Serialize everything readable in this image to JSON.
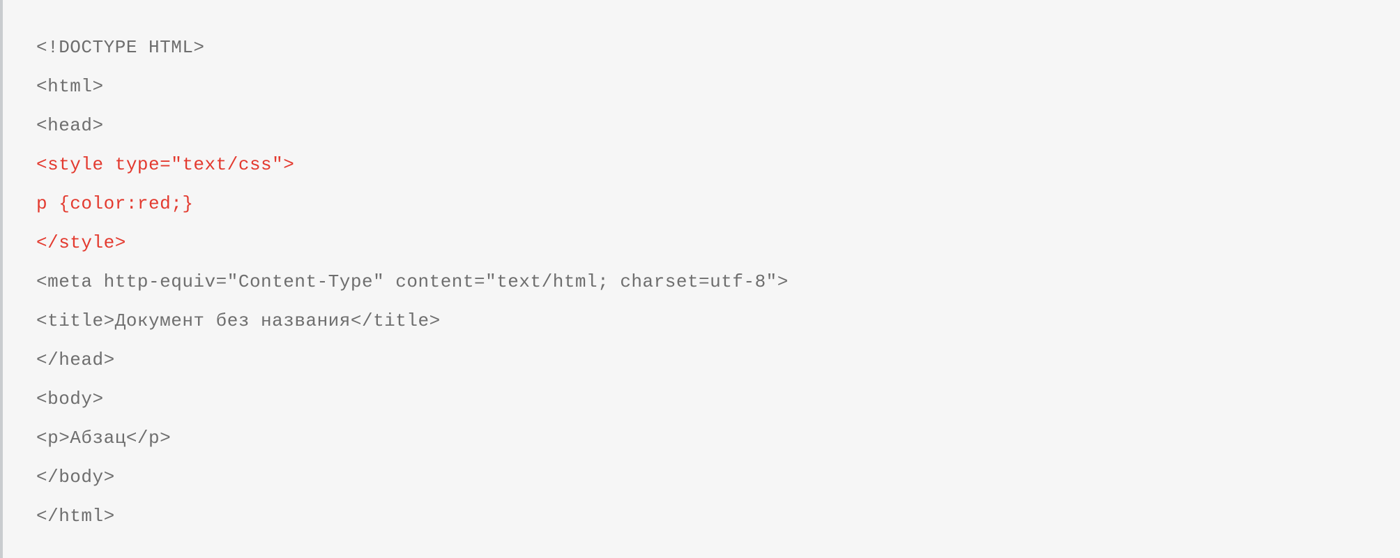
{
  "code": {
    "lines": [
      {
        "text": "<!DOCTYPE HTML>",
        "highlight": false
      },
      {
        "text": "<html>",
        "highlight": false
      },
      {
        "text": "<head>",
        "highlight": false
      },
      {
        "text": "<style type=\"text/css\">",
        "highlight": true
      },
      {
        "text": "p {color:red;}",
        "highlight": true
      },
      {
        "text": "</style>",
        "highlight": true
      },
      {
        "text": "<meta http-equiv=\"Content-Type\" content=\"text/html; charset=utf-8\">",
        "highlight": false
      },
      {
        "text": "<title>Документ без названия</title>",
        "highlight": false
      },
      {
        "text": "</head>",
        "highlight": false
      },
      {
        "text": "<body>",
        "highlight": false
      },
      {
        "text": "<p>Абзац</p>",
        "highlight": false
      },
      {
        "text": "</body>",
        "highlight": false
      },
      {
        "text": "</html>",
        "highlight": false
      }
    ]
  }
}
